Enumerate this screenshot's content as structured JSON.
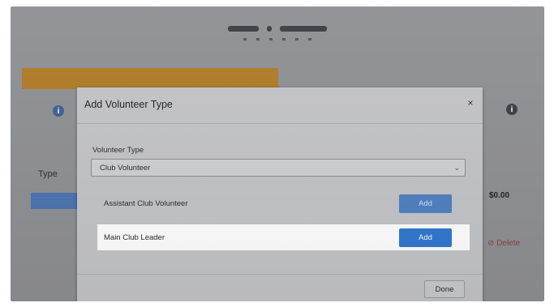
{
  "background": {
    "type_label": "Type",
    "amount": "$0.00",
    "delete_label": "Delete",
    "step_icons": [
      "info-icon",
      "info-icon"
    ]
  },
  "modal": {
    "title": "Add Volunteer Type",
    "close_glyph": "×",
    "field_label": "Volunteer Type",
    "select_value": "Club Volunteer",
    "rows": [
      {
        "label": "Assistant Club Volunteer",
        "button": "Add"
      },
      {
        "label": "Main Club Leader",
        "button": "Add"
      }
    ],
    "done_label": "Done"
  },
  "colors": {
    "overlay": "#8e8f93",
    "modal": "#c3c4c8",
    "banner": "#b07a1d",
    "primary_button": "#2f78d0",
    "highlight_row": "#ffffff"
  }
}
